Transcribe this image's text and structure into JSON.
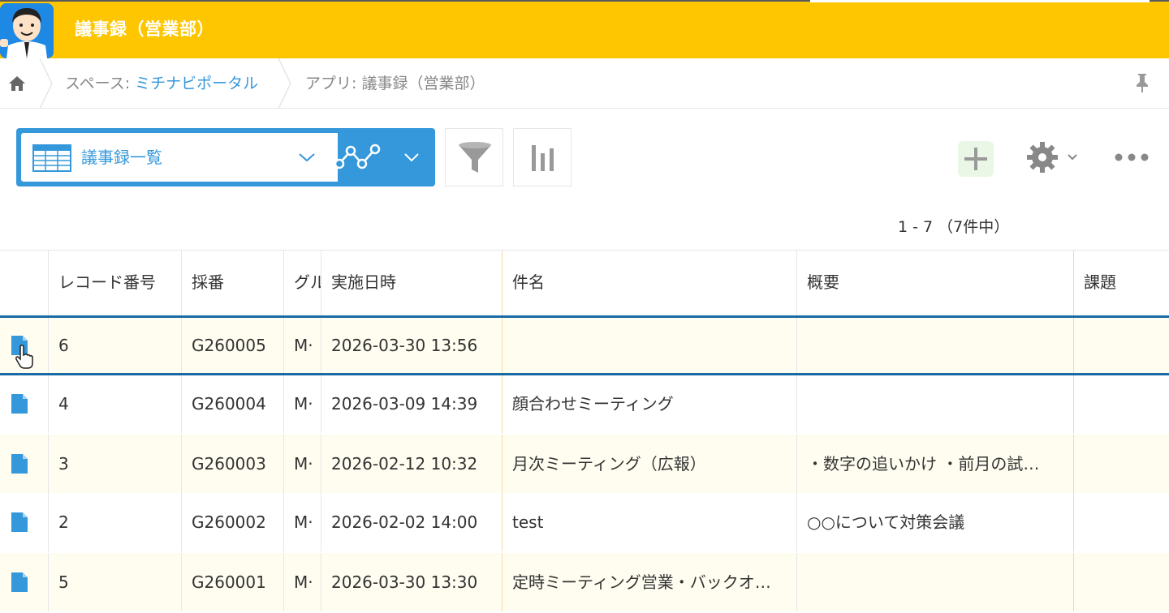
{
  "header": {
    "title": "議事録（営業部）",
    "accent_color": "#fec600"
  },
  "breadcrumb": {
    "home_icon": "home-icon",
    "space_prefix": "スペース: ",
    "space_name": "ミチナビポータル",
    "app_label": "アプリ: 議事録（営業部）",
    "pin_icon": "pin-icon"
  },
  "toolbar": {
    "view_name": "議事録一覧",
    "graph_icon": "graph-icon",
    "filter_icon": "filter-icon",
    "chart_icon": "bar-chart-icon",
    "add_icon": "plus-icon",
    "settings_icon": "gear-icon",
    "more_icon": "more-icon"
  },
  "pagination": {
    "text": "1 - 7 （7件中）"
  },
  "table": {
    "columns": [
      "レコード番号",
      "採番",
      "グル",
      "実施日時",
      "件名",
      "概要",
      "課題"
    ],
    "rows": [
      {
        "record": "6",
        "saiban": "G260005",
        "group": "M·",
        "datetime": "2026-03-30 13:56",
        "subject": "",
        "summary": "",
        "issue": "",
        "selected": true
      },
      {
        "record": "4",
        "saiban": "G260004",
        "group": "M·",
        "datetime": "2026-03-09 14:39",
        "subject": "顔合わせミーティング",
        "summary": "",
        "issue": ""
      },
      {
        "record": "3",
        "saiban": "G260003",
        "group": "M·",
        "datetime": "2026-02-12 10:32",
        "subject": "月次ミーティング（広報）",
        "summary": "・数字の追いかけ ・前月の試…",
        "issue": ""
      },
      {
        "record": "2",
        "saiban": "G260002",
        "group": "M·",
        "datetime": "2026-02-02 14:00",
        "subject": "test",
        "summary": "○○について対策会議",
        "issue": ""
      },
      {
        "record": "5",
        "saiban": "G260001",
        "group": "M·",
        "datetime": "2026-03-30 13:30",
        "subject": "定時ミーティング営業・バックオ…",
        "summary": "",
        "issue": ""
      }
    ]
  }
}
